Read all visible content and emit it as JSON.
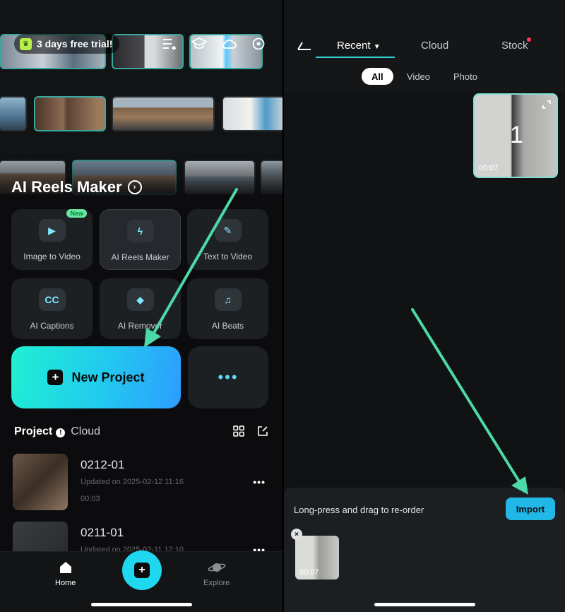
{
  "left": {
    "trial": {
      "label": "3 days free trial!"
    },
    "reels_title": "AI Reels Maker",
    "tools": [
      {
        "label": "Image to Video",
        "badge": "New",
        "icon": "image-video-icon"
      },
      {
        "label": "AI Reels Maker",
        "icon": "lightning-icon"
      },
      {
        "label": "Text  to Video",
        "icon": "text-pen-icon"
      },
      {
        "label": "AI Captions",
        "icon_text": "CC",
        "icon": "captions-icon"
      },
      {
        "label": "AI Remover",
        "icon": "eraser-icon"
      },
      {
        "label": "AI Beats",
        "icon": "beats-icon"
      }
    ],
    "new_project": "New Project",
    "more": "•••",
    "tabs": {
      "project": "Project",
      "cloud": "Cloud",
      "alert": "!"
    },
    "projects": [
      {
        "name": "0212-01",
        "updated": "Updated on 2025-02-12 11:16",
        "duration": "00:03",
        "more": "•••"
      },
      {
        "name": "0211-01",
        "updated": "Updated on 2025-02-11 12:10",
        "more": "•••"
      }
    ],
    "nav": {
      "home": "Home",
      "explore": "Explore",
      "add": "+"
    }
  },
  "right": {
    "tabs": {
      "recent": "Recent",
      "cloud": "Cloud",
      "stock": "Stock"
    },
    "filters": {
      "all": "All",
      "video": "Video",
      "photo": "Photo"
    },
    "media": {
      "selected_number": "1",
      "duration": "00:07"
    },
    "tray": {
      "hint": "Long-press and drag to re-order",
      "import": "Import",
      "close": "×",
      "clip_duration": "00:07"
    }
  },
  "colors": {
    "accent": "#1fd8f0",
    "arrow": "#4cd9a8",
    "tab_underline": "#2fd3d7",
    "badge": "#69e6a3"
  }
}
